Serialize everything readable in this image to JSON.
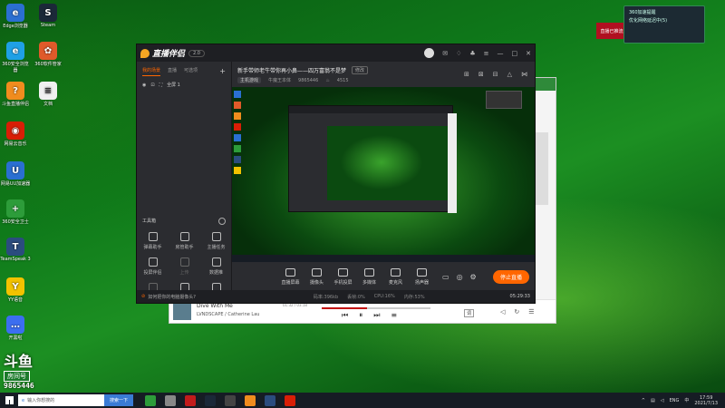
{
  "desktop": {
    "icons": [
      {
        "label": "Edge浏览器",
        "color": "#2b6fd1",
        "glyph": "e"
      },
      {
        "label": "Steam",
        "color": "#1b2838",
        "glyph": "S"
      },
      {
        "label": "360安全浏览器",
        "color": "#1fa0e6",
        "glyph": "e"
      },
      {
        "label": "360软件管家",
        "color": "#e05a2a",
        "glyph": "✿"
      },
      {
        "label": "斗鱼直播伴侣",
        "color": "#f08c1e",
        "glyph": "?"
      },
      {
        "label": "文档",
        "color": "#f0f0f0",
        "glyph": "≡"
      },
      {
        "label": "网易云音乐",
        "color": "#d81e06",
        "glyph": "◉"
      },
      {
        "label": "网易UU加速器",
        "color": "#2a6fd1",
        "glyph": "U"
      },
      {
        "label": "360安全卫士",
        "color": "#2d9c3a",
        "glyph": "+"
      },
      {
        "label": "TeamSpeak 3",
        "color": "#2b4c7e",
        "glyph": "T"
      },
      {
        "label": "YY语音",
        "color": "#f2c200",
        "glyph": "Y"
      },
      {
        "label": "开黑啦",
        "color": "#3c6ef0",
        "glyph": "…"
      }
    ],
    "douyu_badge": {
      "logo": "斗鱼",
      "tag": "房间号",
      "room": "9865446"
    }
  },
  "app": {
    "title": "直播伴侣",
    "version_pill": "2.0",
    "tabs": [
      "我的场景",
      "直播",
      "可选项"
    ],
    "add_tab": "+",
    "scene_label": "全屏 1",
    "stream_title": "新手带师老牛带你再小鼻——四万富翁不是梦",
    "edit_label": "修改",
    "category": "主机游戏",
    "streamer": "牛魔王本体",
    "room_id": "9865446",
    "hot": "4515",
    "tools_title": "工具箱",
    "tools": [
      {
        "label": "弹幕助手",
        "dim": false
      },
      {
        "label": "房管助手",
        "dim": false
      },
      {
        "label": "主播任务",
        "dim": false
      },
      {
        "label": "投屏伴侣",
        "dim": false
      },
      {
        "label": "上传",
        "dim": true
      },
      {
        "label": "数据推",
        "dim": false
      },
      {
        "label": "连线开播",
        "dim": true
      },
      {
        "label": "直播推",
        "dim": false
      },
      {
        "label": "新闻助手",
        "dim": false
      }
    ],
    "controls": [
      {
        "label": "直播屏幕"
      },
      {
        "label": "摄像头"
      },
      {
        "label": "手机投屏"
      },
      {
        "label": "多媒体"
      },
      {
        "label": "麦克风"
      },
      {
        "label": "扬声器"
      }
    ],
    "live_button": "停止直播",
    "status_warning": "如何把你的电脑摄像头?",
    "status_mid": [
      "码率:396kb",
      "丢帧:0%",
      "CPU:16%",
      "内存:53%"
    ],
    "duration": "05:29:33"
  },
  "music": {
    "song": "Dive With Me",
    "artist": "LVNDSCAPE / Catherine Lau",
    "time": "01:32 / 03:18",
    "lyric_btn": "词"
  },
  "notification": {
    "title": "360加速提醒",
    "line": "优化网络延迟中(5)",
    "side": "直播已推流"
  },
  "taskbar": {
    "search_placeholder": "输入你想搜的",
    "search_button": "搜索一下",
    "time": "17:59",
    "date": "2021/7/13",
    "lang": "ENG",
    "tray_label": "中"
  }
}
